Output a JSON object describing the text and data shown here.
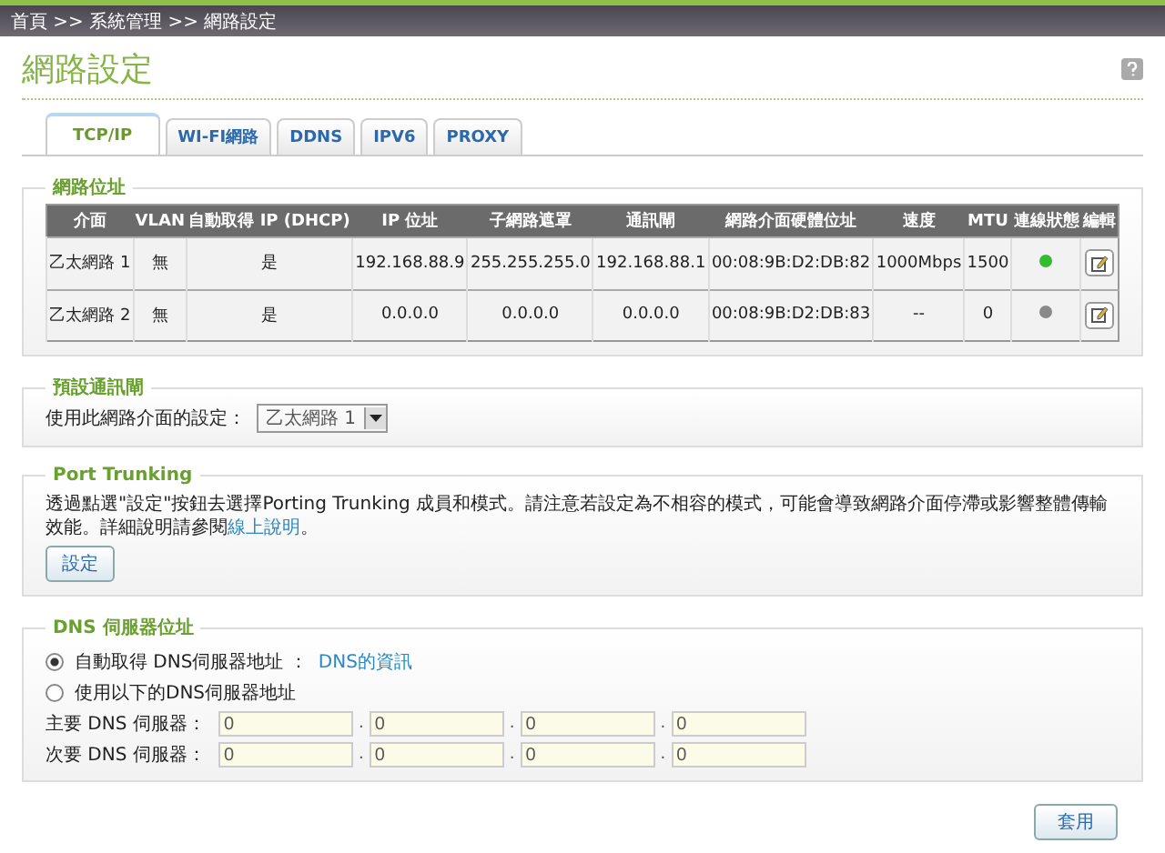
{
  "breadcrumb": "首頁 >> 系統管理 >> 網路設定",
  "title": "網路設定",
  "tabs": [
    {
      "label": "TCP/IP",
      "selected": true
    },
    {
      "label": "WI-FI網路",
      "selected": false
    },
    {
      "label": "DDNS",
      "selected": false
    },
    {
      "label": "IPV6",
      "selected": false
    },
    {
      "label": "PROXY",
      "selected": false
    }
  ],
  "address_section": {
    "legend": "網路位址",
    "columns": [
      "介面",
      "VLAN",
      "自動取得 IP (DHCP)",
      "IP 位址",
      "子網路遮罩",
      "通訊閘",
      "網路介面硬體位址",
      "速度",
      "MTU",
      "連線狀態",
      "編輯"
    ],
    "rows": [
      {
        "cells": [
          "乙太網路 1",
          "無",
          "是",
          "192.168.88.9",
          "255.255.255.0",
          "192.168.88.1",
          "00:08:9B:D2:DB:82",
          "1000Mbps",
          "1500"
        ],
        "color": "#33bb33"
      },
      {
        "cells": [
          "乙太網路 2",
          "無",
          "是",
          "0.0.0.0",
          "0.0.0.0",
          "0.0.0.0",
          "00:08:9B:D2:DB:83",
          "--",
          "0"
        ],
        "color": "#8a8a8a"
      }
    ]
  },
  "gateway_section": {
    "legend": "預設通訊閘",
    "label": "使用此網路介面的設定：",
    "value": "乙太網路 1"
  },
  "trunking_section": {
    "legend": "Port Trunking",
    "text": "透過點選\"設定\"按鈕去選擇Porting Trunking 成員和模式。請注意若設定為不相容的模式，可能會導致網路介面停滯或影響整體傳輸效能。詳細說明請參閱",
    "link": "線上說明",
    "tail": "。",
    "button": "設定"
  },
  "dns_section": {
    "legend": "DNS 伺服器位址",
    "options": [
      {
        "label": "自動取得 DNS伺服器地址 ：",
        "link": "DNS的資訊",
        "selected": true
      },
      {
        "label": "使用以下的DNS伺服器地址",
        "selected": false
      }
    ],
    "separator": ".",
    "servers": [
      {
        "label": "主要 DNS 伺服器：",
        "octets": [
          "0",
          "0",
          "0",
          "0"
        ]
      },
      {
        "label": "次要 DNS 伺服器：",
        "octets": [
          "0",
          "0",
          "0",
          "0"
        ]
      }
    ]
  },
  "apply_button": "套用"
}
